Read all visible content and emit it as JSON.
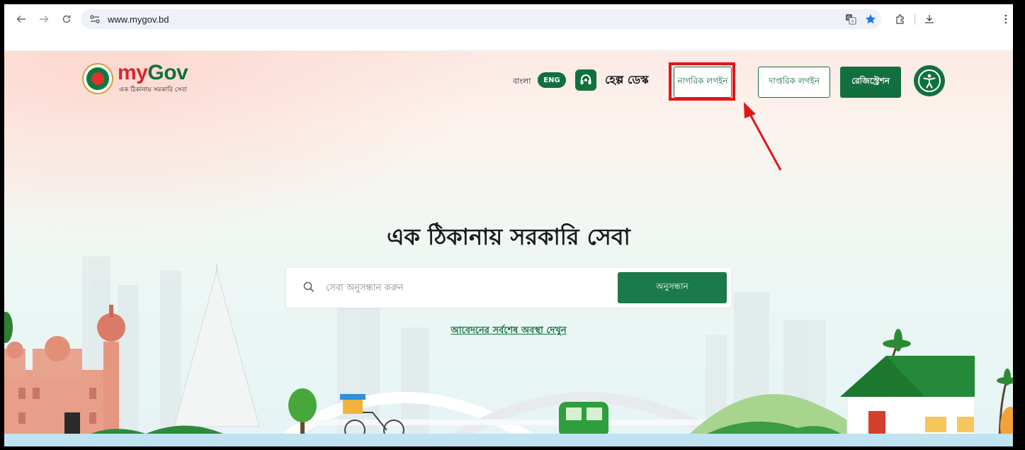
{
  "browser": {
    "url": "www.mygov.bd"
  },
  "header": {
    "logo_my": "my",
    "logo_gov": "Gov",
    "logo_tagline": "এক ঠিকানায় সরকারি সেবা",
    "lang_bangla": "বাংলা",
    "lang_english": "ENG",
    "help_desk": "হেল্প ডেস্ক",
    "citizen_login": "নাগরিক লগইন",
    "office_login": "দাপ্তরিক লগইন",
    "registration": "রেজিস্ট্রেশন"
  },
  "hero": {
    "title": "এক ঠিকানায় সরকারি সেবা",
    "search_placeholder": "সেবা অনুসন্ধান করুন",
    "search_button": "অনুসন্ধান",
    "status_link": "আবেদনের সর্বশেষ অবস্থা দেখুন"
  },
  "colors": {
    "brand_green": "#12703f",
    "brand_red": "#d7262d",
    "annotation_red": "#e1161b"
  },
  "icons": [
    "back-icon",
    "forward-icon",
    "reload-icon",
    "site-info-icon",
    "translate-icon",
    "star-icon",
    "extensions-icon",
    "download-icon",
    "menu-icon",
    "headset-icon",
    "accessibility-icon",
    "search-icon"
  ]
}
